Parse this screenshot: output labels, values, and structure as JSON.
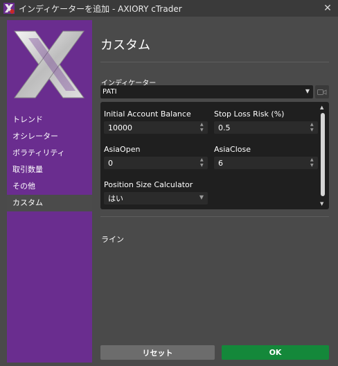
{
  "window": {
    "title": "インディケーターを追加 - AXIORY cTrader",
    "close_glyph": "✕"
  },
  "sidebar": {
    "items": [
      {
        "label": "トレンド",
        "active": false
      },
      {
        "label": "オシレーター",
        "active": false
      },
      {
        "label": "ボラティリティ",
        "active": false
      },
      {
        "label": "取引数量",
        "active": false
      },
      {
        "label": "その他",
        "active": false
      },
      {
        "label": "カスタム",
        "active": true
      }
    ]
  },
  "main": {
    "title": "カスタム",
    "indicator_label": "インディケーター",
    "indicator_value": "PATI",
    "params": {
      "initial_balance": {
        "label": "Initial Account Balance",
        "value": "10000"
      },
      "stop_loss": {
        "label": "Stop Loss Risk (%)",
        "value": "0.5"
      },
      "asia_open": {
        "label": "AsiaOpen",
        "value": "0"
      },
      "asia_close": {
        "label": "AsiaClose",
        "value": "6"
      },
      "position_size": {
        "label": "Position Size Calculator",
        "value": "はい"
      }
    },
    "lines_label": "ライン"
  },
  "buttons": {
    "reset": "リセット",
    "ok": "OK"
  },
  "colors": {
    "sidebar": "#6a2d8f",
    "ok": "#14883a",
    "panel": "#1f1f1f",
    "background": "#4a4a4a"
  }
}
